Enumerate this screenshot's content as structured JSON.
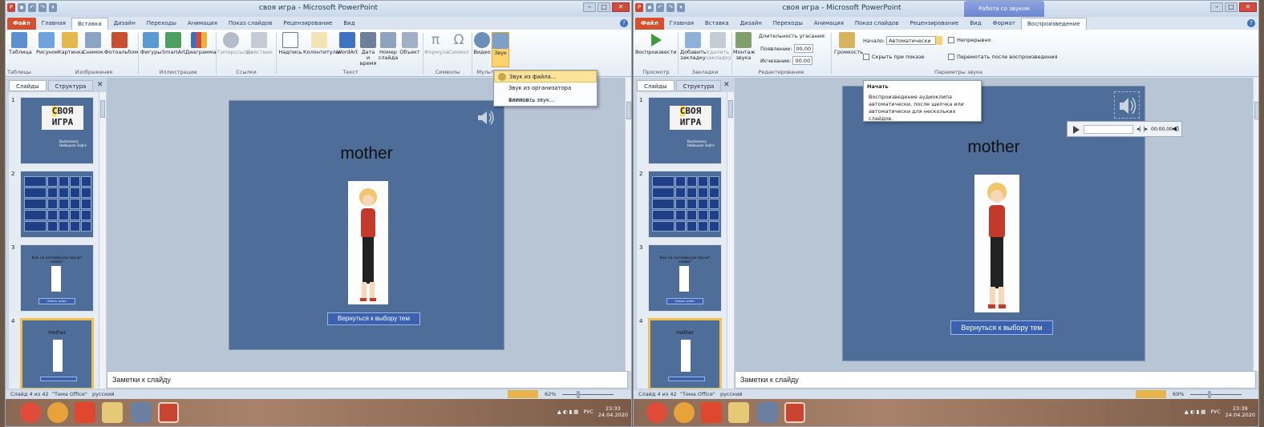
{
  "left": {
    "window_title": "своя игра - Microsoft PowerPoint",
    "tabs": [
      "Файл",
      "Главная",
      "Вставка",
      "Дизайн",
      "Переходы",
      "Анимация",
      "Показ слайдов",
      "Рецензирование",
      "Вид"
    ],
    "ribbon": {
      "buttons": [
        "Таблица",
        "Рисунок",
        "Картинка",
        "Снимок",
        "Фотоальбом",
        "Фигуры",
        "SmartArt",
        "Диаграмма",
        "Гиперссылка",
        "Действие",
        "Надпись",
        "Колонтитулы",
        "WordArt",
        "Дата и время",
        "Номер слайда",
        "Объект",
        "Формула",
        "Символ",
        "Видео",
        "Звук"
      ],
      "groups": [
        "Таблицы",
        "Изображения",
        "Иллюстрации",
        "Ссылки",
        "Текст",
        "Символы",
        "Мульт"
      ]
    },
    "sound_menu": [
      "Звук из файла...",
      "Звук из организатора клипов...",
      "Записать звук..."
    ],
    "panel_tabs": [
      "Слайды",
      "Структура"
    ],
    "slide_numbers": [
      "1",
      "2",
      "3",
      "4"
    ],
    "slide1": {
      "logo_top": [
        "С",
        "ВОЯ"
      ],
      "logo_bottom": "ИГРА",
      "credit": "Выполнила\nНабоцкая Зоф'я"
    },
    "slide3_text": "Как на английском звучит слово?",
    "slide3_button": "Узнать ответ",
    "slide4_word": "mother",
    "main_word": "mother",
    "back_button": "Вернуться к выбору тем",
    "notes": "Заметки к слайду",
    "status": {
      "slide": "Слайд 4 из 42",
      "theme": "\"Тема Office\"",
      "lang": "русский",
      "zoom": "62%"
    },
    "tray": {
      "lang": "РУС",
      "time": "23:33",
      "date": "24.04.2020"
    }
  },
  "right": {
    "window_title": "своя игра - Microsoft PowerPoint",
    "context_tab": "Работа со звуком",
    "tabs": [
      "Файл",
      "Главная",
      "Вставка",
      "Дизайн",
      "Переходы",
      "Анимация",
      "Показ слайдов",
      "Рецензирование",
      "Вид",
      "Формат",
      "Воспроизведение"
    ],
    "ribbon": {
      "play": "Воспроизвести",
      "add_bookmark": "Добавить закладку",
      "remove_bookmark": "Удалить закладку",
      "trim": "Монтаж звука",
      "fade_title": "Длительность угасания",
      "fade_in_label": "Появление:",
      "fade_in_value": "00,00",
      "fade_out_label": "Исчезание:",
      "fade_out_value": "00,00",
      "volume": "Громкость",
      "start_label": "Начало:",
      "start_value": "Автоматически",
      "hide": "Скрыть при показе",
      "loop": "Непрерывно",
      "rewind": "Перемотать после воспроизведения",
      "groups": [
        "Просмотр",
        "Закладки",
        "Редактирование",
        "Параметры звука"
      ]
    },
    "tooltip": {
      "title": "Начать",
      "body": "Воспроизведение аудиоклипа автоматически, после щелчка или автоматически для нескольких слайдов."
    },
    "player_time": "00:00,00",
    "panel_tabs": [
      "Слайды",
      "Структура"
    ],
    "slide_numbers": [
      "1",
      "2",
      "3",
      "4"
    ],
    "main_word": "mother",
    "back_button": "Вернуться к выбору тем",
    "notes": "Заметки к слайду",
    "status": {
      "slide": "Слайд 4 из 42",
      "theme": "\"Тема Office\"",
      "lang": "русский",
      "zoom": "69%"
    },
    "tray": {
      "lang": "РУС",
      "time": "23:39",
      "date": "24.04.2020"
    }
  },
  "colors": {
    "slide_bg": "#4e6d98",
    "accent_file": "#d4502f",
    "button_blue": "#3a62b0",
    "highlight": "#fbe39c"
  }
}
